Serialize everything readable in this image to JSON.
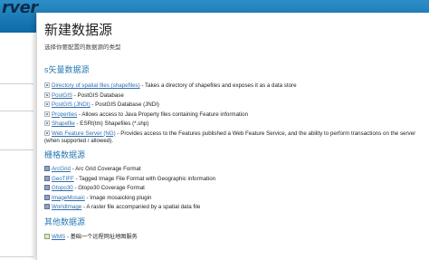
{
  "brand": {
    "text": "rver"
  },
  "page": {
    "title": "新建数据源",
    "subtitle": "选择你要配置的数据源的类型"
  },
  "sections": {
    "vector": {
      "header": "s矢量数据源",
      "items": [
        {
          "link": "Directory of spatial files (shapefiles)",
          "desc": " - Takes a directory of shapefiles and exposes it as a data store",
          "icon": "vector-store-icon"
        },
        {
          "link": "PostGIS",
          "desc": " - PostGIS Database",
          "icon": "vector-store-icon"
        },
        {
          "link": "PostGIS (JNDI)",
          "desc": " - PostGIS Database (JNDI)",
          "icon": "vector-store-icon"
        },
        {
          "link": "Properties",
          "desc": " - Allows access to Java Property files containing Feature information",
          "icon": "vector-store-icon"
        },
        {
          "link": "Shapefile",
          "desc": " - ESRI(tm) Shapefiles (*.shp)",
          "icon": "vector-store-icon"
        },
        {
          "link": "Web Feature Server (NG)",
          "desc": " - Provides access to the Features published a Web Feature Service, and the ability to perform transactions on the server (when supported / allowed).",
          "icon": "vector-store-icon"
        }
      ]
    },
    "raster": {
      "header": "栅格数据源",
      "items": [
        {
          "link": "ArcGrid",
          "desc": " - Arc Grid Coverage Format",
          "icon": "raster-store-icon"
        },
        {
          "link": "GeoTIFF",
          "desc": " - Tagged Image File Format with Geographic information",
          "icon": "raster-store-icon"
        },
        {
          "link": "Gtopo30",
          "desc": " - Gtopo30 Coverage Format",
          "icon": "raster-store-icon"
        },
        {
          "link": "ImageMosaic",
          "desc": " - Image mosaicking plugin",
          "icon": "raster-store-icon"
        },
        {
          "link": "WorldImage",
          "desc": " - A raster file accompanied by a spatial data file",
          "icon": "raster-store-icon"
        }
      ]
    },
    "other": {
      "header": "其他数据源",
      "items": [
        {
          "link": "WMS",
          "desc": " - 基础一个远程网址地图服务",
          "icon": "wms-store-icon"
        }
      ]
    }
  }
}
